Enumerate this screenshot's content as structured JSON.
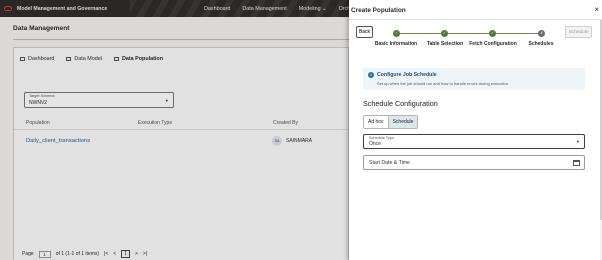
{
  "app": {
    "title": "Model Management and Governance",
    "nav": [
      "Dashboard",
      "Data Management",
      "Modeling ⌄",
      "Orchestrat"
    ]
  },
  "page": {
    "title": "Data Management",
    "tabs": [
      {
        "label": "Dashboard",
        "icon": "dashboard-icon"
      },
      {
        "label": "Data Model",
        "icon": "data-model-icon"
      },
      {
        "label": "Data Population",
        "icon": "data-population-icon"
      }
    ],
    "schema_field": {
      "label": "Target Schema",
      "value": "NWNV2"
    },
    "columns": [
      "Population",
      "Execution Type",
      "Created By"
    ],
    "rows": [
      {
        "population": "Daily_client_transactions",
        "created_by_initials": "SA",
        "created_by": "SAINMARA"
      }
    ],
    "pager": {
      "page_label": "Page",
      "page_value": "1",
      "of_text": "of 1 (1-1 of 1 items)",
      "first": "|<",
      "prev": "<",
      "current": "1",
      "next": ">",
      "last": ">|"
    }
  },
  "drawer": {
    "title": "Create Population",
    "close": "×",
    "back_label": "Back",
    "next_label": "Schedule",
    "steps": [
      {
        "label": "Basic Information",
        "glyph": "✓"
      },
      {
        "label": "Table Selection",
        "glyph": "✓"
      },
      {
        "label": "Fetch Configuration",
        "glyph": "✓"
      },
      {
        "label": "Schedules",
        "glyph": "4"
      }
    ],
    "info": {
      "title": "Configure Job Schedule",
      "description": "Set up when the job should run and how to handle errors during execution.",
      "icon": "info-icon"
    },
    "section_title": "Schedule Configuration",
    "segments": [
      "Ad hoc",
      "Schedule"
    ],
    "selected_segment": "Schedule",
    "schedule_type": {
      "label": "Schedule Type",
      "value": "Once"
    },
    "start_date": {
      "placeholder": "Start Date & Time"
    }
  },
  "colors": {
    "topbar": "#312d2a",
    "step_done": "#50793b",
    "link": "#2a5e9c",
    "info_bg": "#eef4f8"
  }
}
